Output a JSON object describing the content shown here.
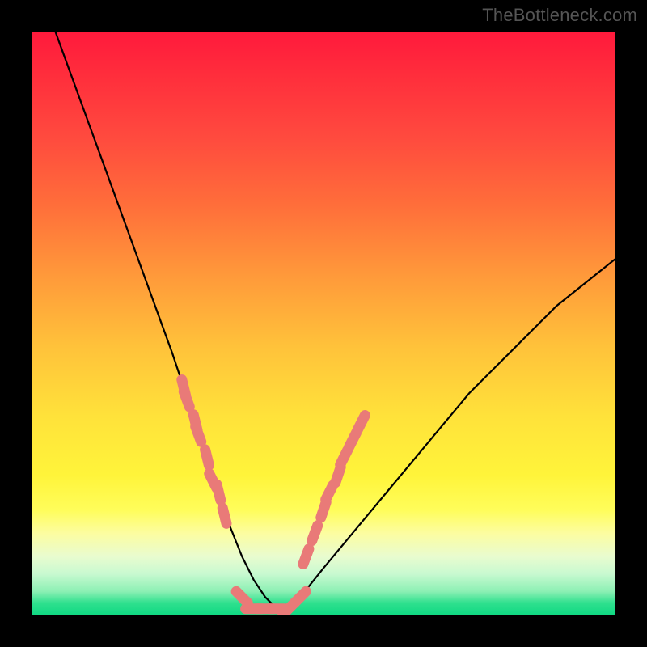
{
  "watermark": "TheBottleneck.com",
  "colors": {
    "frame": "#000000",
    "curve": "#000000",
    "marker": "#e97a78",
    "gradient_top": "#ff1a3c",
    "gradient_mid": "#ffe23a",
    "gradient_bottom": "#11d983"
  },
  "chart_data": {
    "type": "line",
    "title": "",
    "xlabel": "",
    "ylabel": "",
    "xlim": [
      0,
      100
    ],
    "ylim": [
      0,
      100
    ],
    "grid": false,
    "legend": false,
    "annotations": [],
    "series": [
      {
        "name": "curve",
        "x": [
          4,
          8,
          12,
          16,
          20,
          24,
          26,
          28,
          30,
          32,
          34,
          36,
          38,
          40,
          42,
          44,
          46,
          50,
          55,
          60,
          65,
          70,
          75,
          80,
          85,
          90,
          95,
          100
        ],
        "y": [
          100,
          89,
          78,
          67,
          56,
          45,
          39,
          33,
          27,
          21,
          15,
          10,
          6,
          3,
          1,
          1,
          3,
          8,
          14,
          20,
          26,
          32,
          38,
          43,
          48,
          53,
          57,
          61
        ]
      }
    ],
    "markers": [
      {
        "name": "left-dashes",
        "x": [
          26,
          26.5,
          28,
          28.5,
          30,
          31,
          32,
          33
        ],
        "y": [
          39,
          37,
          33,
          31,
          27,
          23,
          21,
          17
        ]
      },
      {
        "name": "valley-dashes",
        "x": [
          36,
          38,
          40,
          42,
          44,
          46
        ],
        "y": [
          3,
          1,
          1,
          1,
          1,
          3
        ]
      },
      {
        "name": "right-dashes",
        "x": [
          47,
          48.5,
          50,
          51,
          52.5,
          53.5,
          55,
          56.5
        ],
        "y": [
          10,
          14,
          18,
          21,
          24,
          27,
          30,
          33
        ]
      }
    ]
  }
}
